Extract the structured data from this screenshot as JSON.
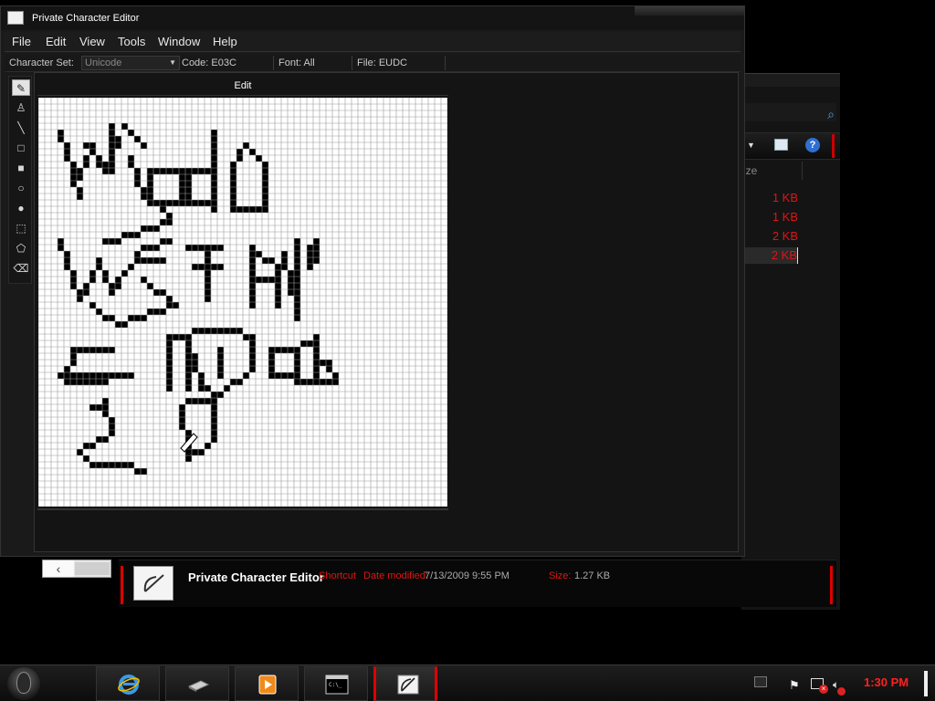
{
  "window": {
    "title": "Private Character Editor"
  },
  "menu": [
    "File",
    "Edit",
    "View",
    "Tools",
    "Window",
    "Help"
  ],
  "infobar": {
    "charset_label": "Character Set:",
    "charset_value": "Unicode",
    "code": "Code: E03C",
    "font": "Font: All",
    "file": "File: EUDC"
  },
  "tools": [
    {
      "name": "pencil-tool-icon",
      "glyph": "✎",
      "active": true
    },
    {
      "name": "brush-tool-icon",
      "glyph": "♙",
      "active": false
    },
    {
      "name": "line-tool-icon",
      "glyph": "╲",
      "active": false
    },
    {
      "name": "hollow-rectangle-tool-icon",
      "glyph": "□",
      "active": false
    },
    {
      "name": "filled-rectangle-tool-icon",
      "glyph": "■",
      "active": false
    },
    {
      "name": "hollow-ellipse-tool-icon",
      "glyph": "○",
      "active": false
    },
    {
      "name": "filled-ellipse-tool-icon",
      "glyph": "●",
      "active": false
    },
    {
      "name": "rectangular-selection-tool-icon",
      "glyph": "⬚",
      "active": false
    },
    {
      "name": "freeform-selection-tool-icon",
      "glyph": "⬠",
      "active": false
    },
    {
      "name": "eraser-tool-icon",
      "glyph": "⌫",
      "active": false
    }
  ],
  "edit_panel": {
    "header": "Edit",
    "grid_size": 64
  },
  "explorer": {
    "column_header": "ize",
    "sizes": [
      "1 KB",
      "1 KB",
      "2 KB",
      "2 KB"
    ],
    "selected_index": 3
  },
  "details": {
    "name": "Private Character Editor",
    "type": "Shortcut",
    "date_label": "Date modified:",
    "date_value": "7/13/2009 9:55 PM",
    "size_label": "Size:",
    "size_value": "1.27 KB"
  },
  "taskbar": {
    "buttons": [
      {
        "name": "internet-explorer-taskbar-button",
        "icon": "ie-icon"
      },
      {
        "name": "network-taskbar-button",
        "icon": "network-icon"
      },
      {
        "name": "media-player-taskbar-button",
        "icon": "media-player-icon"
      },
      {
        "name": "command-prompt-taskbar-button",
        "icon": "cmd-icon"
      },
      {
        "name": "private-character-editor-taskbar-button",
        "icon": "eudc-icon",
        "active": true
      }
    ],
    "clock": "1:30 PM"
  },
  "colors": {
    "accent": "#e01414",
    "grid_ink": "#000000",
    "grid_bg": "#ffffff"
  }
}
